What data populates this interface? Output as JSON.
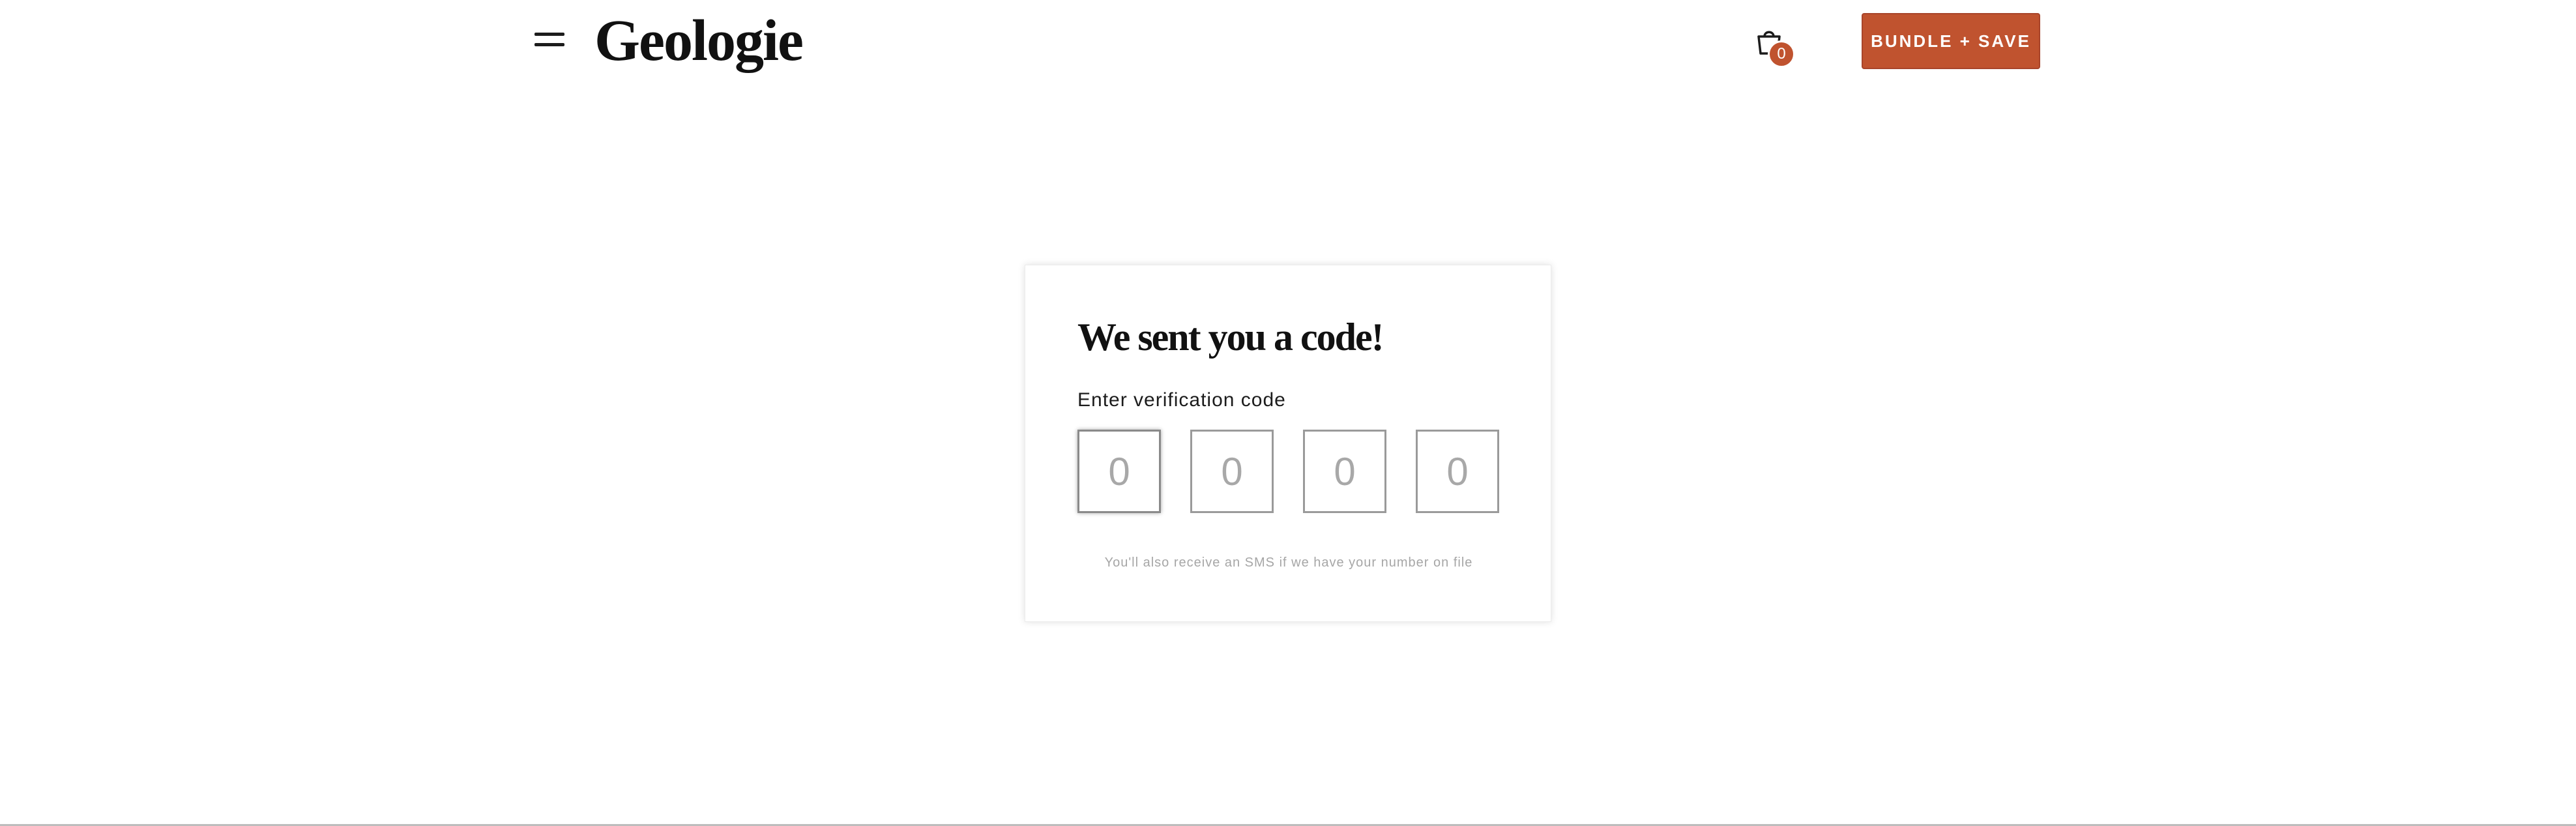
{
  "header": {
    "logo_text": "Geologie",
    "menu_icon": "hamburger-menu-icon",
    "cart_icon": "shopping-bag-icon",
    "cart_count": "0",
    "bundle_button_label": "BUNDLE + SAVE"
  },
  "verification": {
    "title": "We sent you a code!",
    "field_label": "Enter verification code",
    "digit_placeholders": [
      "0",
      "0",
      "0",
      "0"
    ],
    "sms_note": "You'll also receive an SMS if we have your number on file"
  },
  "colors": {
    "accent": "#c0532f",
    "text": "#111111",
    "muted": "#a6a6a6"
  }
}
